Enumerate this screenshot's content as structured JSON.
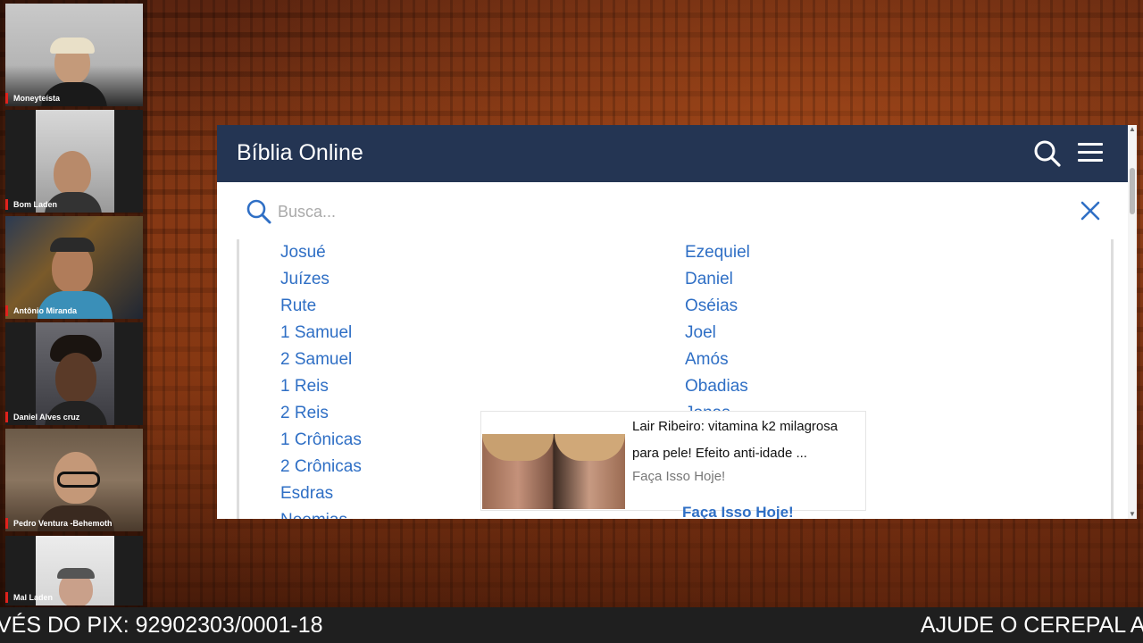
{
  "participants": [
    {
      "name": "Moneyteísta"
    },
    {
      "name": "Bom Laden"
    },
    {
      "name": "Antônio Miranda"
    },
    {
      "name": "Daniel Alves cruz"
    },
    {
      "name": "Pedro Ventura -Behemoth"
    },
    {
      "name": "Mal Laden"
    }
  ],
  "app": {
    "title": "Bíblia Online",
    "search_icon": "search-icon",
    "menu_icon": "menu-icon"
  },
  "search": {
    "placeholder": "Busca...",
    "value": "",
    "close_icon": "close-icon"
  },
  "books": {
    "left": [
      "Josué",
      "Juízes",
      "Rute",
      "1 Samuel",
      "2 Samuel",
      "1 Reis",
      "2 Reis",
      "1 Crônicas",
      "2 Crônicas",
      "Esdras",
      "Neemias"
    ],
    "right": [
      "Ezequiel",
      "Daniel",
      "Oséias",
      "Joel",
      "Amós",
      "Obadias",
      "Jonas"
    ]
  },
  "ad": {
    "title_line1": "Lair Ribeiro: vitamina k2 milagrosa",
    "title_line2": "para pele! Efeito anti-idade    ...",
    "cta": "Faça Isso Hoje!",
    "link": "Faça Isso Hoje!"
  },
  "ticker": {
    "left": "VÉS DO PIX: 92902303/0001-18",
    "right": "AJUDE O CEREPAL A"
  },
  "colors": {
    "appbar": "#243553",
    "link": "#2f6fc5",
    "name_accent": "#e0221d"
  }
}
